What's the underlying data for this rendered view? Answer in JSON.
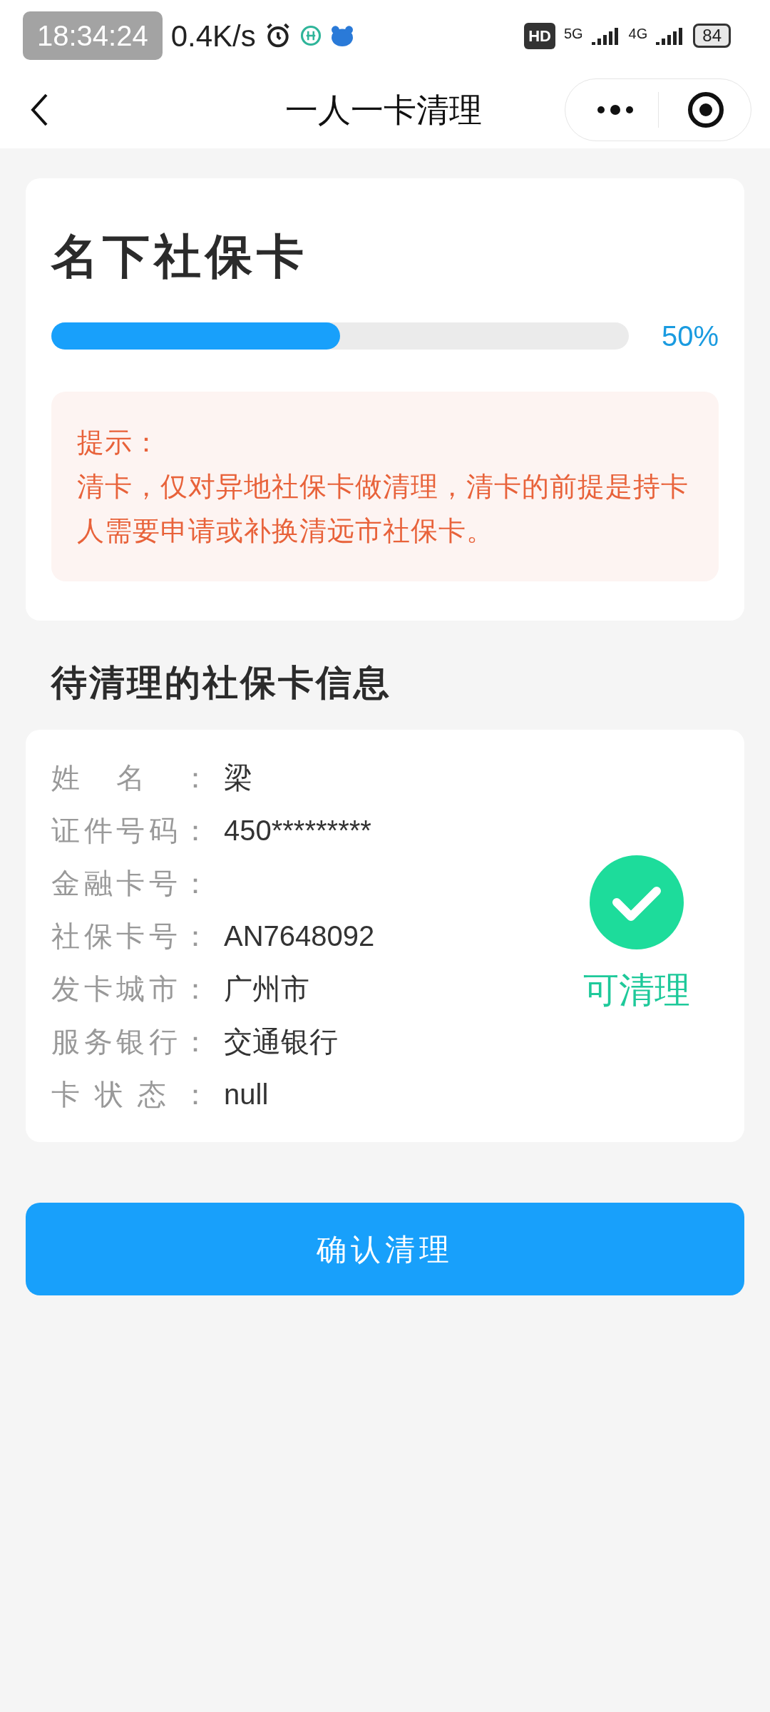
{
  "overlay_clock": "18:34:24",
  "status_bar": {
    "speed": "0.4K/s",
    "hd": "HD",
    "network_1": "5G",
    "network_2": "4G",
    "battery": "84"
  },
  "nav": {
    "title": "一人一卡清理"
  },
  "summary": {
    "title": "名下社保卡",
    "progress": {
      "level": 0.5,
      "reading": "50%"
    },
    "notice": {
      "heading": "提示：",
      "body": "清卡，仅对异地社保卡做清理，清卡的前提是持卡人需要申请或补换清远市社保卡。"
    }
  },
  "section_title": "待清理的社保卡信息",
  "card": {
    "fields": [
      {
        "label": "姓名：",
        "value": "梁"
      },
      {
        "label": "证件号码：",
        "value": "450*********"
      },
      {
        "label": "金融卡号："
      },
      {
        "label": "社保卡号：",
        "value": "AN7648092"
      },
      {
        "label": "发卡城市：",
        "value": "广州市"
      },
      {
        "label": "服务银行：",
        "value": "交通银行"
      },
      {
        "label": "卡状态：",
        "value": "null"
      }
    ],
    "status": {
      "cleanable": true,
      "label": "可清理"
    }
  },
  "confirm_button": "确认清理"
}
